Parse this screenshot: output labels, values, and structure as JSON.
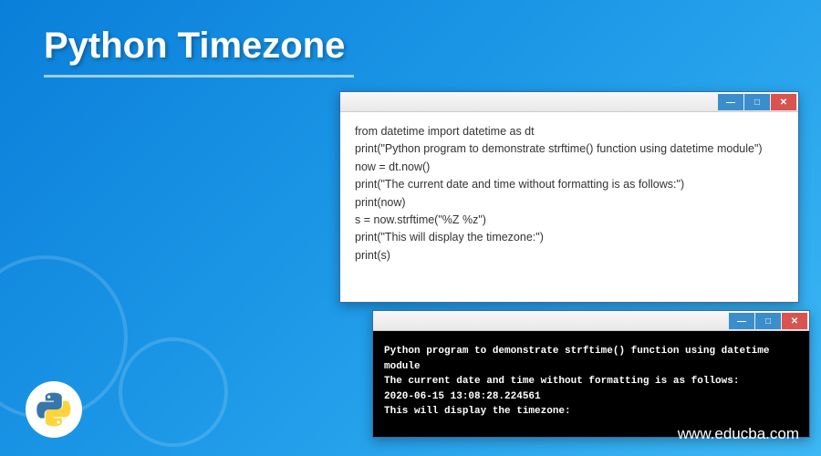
{
  "title": "Python Timezone",
  "code_window": {
    "lines": [
      "from datetime import datetime as dt",
      "print(\"Python program to demonstrate strftime() function using datetime module\")",
      "now = dt.now()",
      "print(\"The current date and time without formatting is as follows:\")",
      "print(now)",
      "s = now.strftime(\"%Z %z\")",
      "print(\"This will display the timezone:\")",
      "print(s)"
    ]
  },
  "output_window": {
    "lines": [
      "Python program to demonstrate strftime() function using datetime module",
      "The current date and time without formatting is as follows:",
      "2020-06-15 13:08:28.224561",
      "This will display the timezone:"
    ]
  },
  "window_buttons": {
    "min": "—",
    "max": "□",
    "close": "✕"
  },
  "watermark": "www.educba.com"
}
